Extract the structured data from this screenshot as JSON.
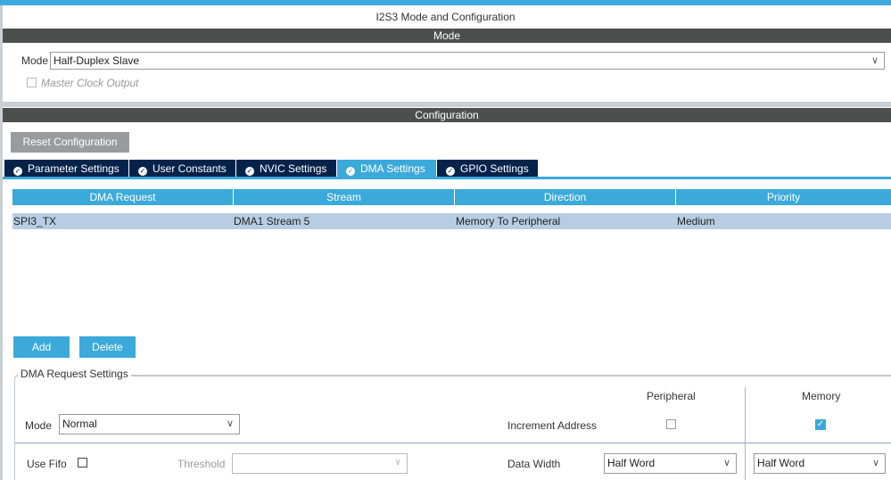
{
  "title": "I2S3 Mode and Configuration",
  "mode_section": {
    "header": "Mode",
    "mode_label": "Mode",
    "mode_value": "Half-Duplex Slave",
    "master_clock_label": "Master Clock Output",
    "master_clock_checked": false
  },
  "config_section": {
    "header": "Configuration",
    "reset_label": "Reset Configuration"
  },
  "tabs": [
    {
      "label": "Parameter Settings"
    },
    {
      "label": "User Constants"
    },
    {
      "label": "NVIC Settings"
    },
    {
      "label": "DMA Settings",
      "active": true
    },
    {
      "label": "GPIO Settings"
    }
  ],
  "table": {
    "headers": [
      "DMA Request",
      "Stream",
      "Direction",
      "Priority"
    ],
    "rows": [
      [
        "SPI3_TX",
        "DMA1 Stream 5",
        "Memory To Peripheral",
        "Medium"
      ]
    ]
  },
  "buttons": {
    "add": "Add",
    "delete": "Delete"
  },
  "dma_settings": {
    "legend": "DMA Request Settings",
    "peripheral": "Peripheral",
    "memory": "Memory",
    "mode_label": "Mode",
    "mode_value": "Normal",
    "increment_label": "Increment Address",
    "inc_peripheral": false,
    "inc_memory": true,
    "use_fifo_label": "Use Fifo",
    "use_fifo": false,
    "threshold_label": "Threshold",
    "threshold_value": "",
    "data_width_label": "Data Width",
    "periph_width": "Half Word",
    "mem_width": "Half Word"
  },
  "colors": {
    "accent": "#3ca9db",
    "tab_dark": "#03234b",
    "header": "#4d4f4e"
  }
}
